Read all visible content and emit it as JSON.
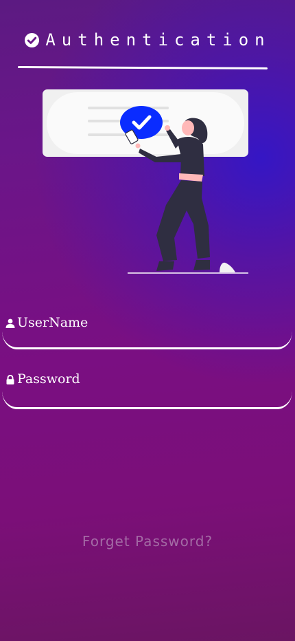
{
  "header": {
    "title": "Authentication",
    "icon": "check-circle-icon"
  },
  "illustration": {
    "icon": "verified-check-icon",
    "accent_color": "#0a2cff"
  },
  "form": {
    "username": {
      "label": "UserName",
      "icon": "user-icon"
    },
    "password": {
      "label": "Password",
      "icon": "lock-icon"
    }
  },
  "links": {
    "forget_password": "Forget Password?"
  },
  "colors": {
    "background_top": "#5c1a82",
    "background_glow": "#3216c8",
    "background_bottom": "#7b0f78",
    "text": "#ffffff",
    "link": "#c8b4cd"
  }
}
